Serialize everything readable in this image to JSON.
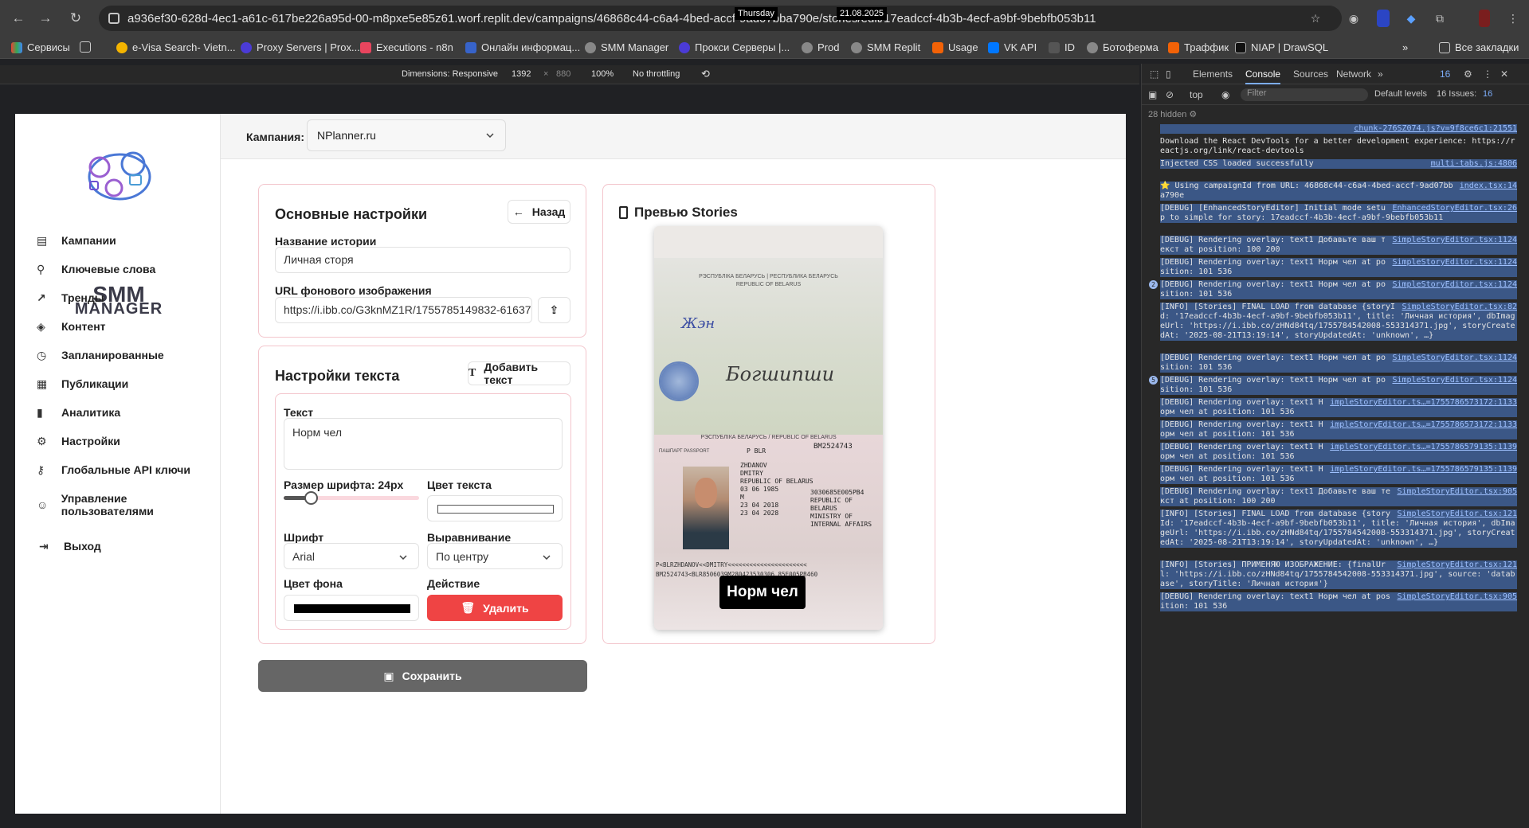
{
  "browser": {
    "url": "a936ef30-628d-4ec1-a61c-617be226a95d-00-m8pxe5e85z61.worf.replit.dev/campaigns/46868c44-c6a4-4bed-accf-9ad07bba790e/stories/edit/17eadccf-4b3b-4ecf-a9bf-9bebfb053b11",
    "tooltip_day": "Thursday",
    "tooltip_date": "21.08.2025",
    "bookmarks": [
      "Сервисы",
      "e-Visa Search- Vietn...",
      "Proxy Servers | Prox...",
      "Executions - n8n",
      "Онлайн информац...",
      "SMM Manager",
      "Прокси Серверы |...",
      "Prod",
      "SMM Replit",
      "Usage",
      "VK API",
      "ID",
      "Ботоферма",
      "Траффик",
      "NIAP | DrawSQL"
    ],
    "all_bookmarks": "Все закладки"
  },
  "device_toolbar": {
    "dimensions_label": "Dimensions: Responsive",
    "width": "1392",
    "x": "×",
    "height": "880",
    "zoom": "100%",
    "throttle": "No throttling"
  },
  "sidebar": {
    "logo_line1": "SMM",
    "logo_line2": "MANAGER",
    "items": [
      "Кампании",
      "Ключевые слова",
      "Тренды",
      "Контент",
      "Запланированные",
      "Публикации",
      "Аналитика",
      "Настройки",
      "Глобальные API ключи",
      "Управление пользователями"
    ],
    "logout": "Выход"
  },
  "header": {
    "campaign_label": "Кампания:",
    "campaign_value": "NPlanner.ru"
  },
  "basic": {
    "title": "Основные настройки",
    "back": "Назад",
    "story_name_label": "Название истории",
    "story_name_value": "Личная сторя",
    "bg_url_label": "URL фонового изображения",
    "bg_url_value": "https://i.ibb.co/G3knMZ1R/1755785149832-616376551-pass"
  },
  "text_settings": {
    "title": "Настройки текста",
    "add_text": "Добавить текст",
    "text_label": "Текст",
    "text_value": "Норм чел",
    "font_size_label": "Размер шрифта: 24px",
    "font_size_value": 24,
    "text_color_label": "Цвет текста",
    "text_color": "#ffffff",
    "font_label": "Шрифт",
    "font_value": "Arial",
    "align_label": "Выравнивание",
    "align_value": "По центру",
    "bg_color_label": "Цвет фона",
    "bg_color": "#000000",
    "action_label": "Действие",
    "delete": "Удалить"
  },
  "save": "Сохранить",
  "preview": {
    "title": "Превью Stories",
    "overlay_text": "Норм чел"
  },
  "devtools": {
    "tabs": [
      "Elements",
      "Console",
      "Sources",
      "Network"
    ],
    "issues_badge": "16",
    "context": "top",
    "filter_placeholder": "Filter",
    "levels": "Default levels",
    "issues": "16 Issues:",
    "issues_count": "16",
    "hidden": "28 hidden",
    "logs": [
      {
        "src": "chunk-276SZ074.js?v=9f8ce6c1:21551",
        "text": ""
      },
      {
        "src": "",
        "text": "Download the React DevTools for a better development experience: https://reactjs.org/link/react-devtools",
        "plain": true
      },
      {
        "src": "multi-tabs.js:4806",
        "text": "Injected CSS loaded successfully"
      },
      {
        "src": "index.tsx:14",
        "text": "⭐ Using campaignId from URL: 46868c44-c6a4-4bed-accf-9ad07bba790e"
      },
      {
        "src": "EnhancedStoryEditor.tsx:26",
        "text": "[DEBUG] [EnhancedStoryEditor] Initial mode setup to simple for story: 17eadccf-4b3b-4ecf-a9bf-9bebfb053b11"
      },
      {
        "src": "SimpleStoryEditor.tsx:1124",
        "text": "[DEBUG] Rendering overlay: text1 Добавьте ваш текст at position: 100 200"
      },
      {
        "src": "SimpleStoryEditor.tsx:1124",
        "text": "[DEBUG] Rendering overlay: text1 Норм чел at position: 101 536"
      },
      {
        "src": "SimpleStoryEditor.tsx:1124",
        "text": "[DEBUG] Rendering overlay: text1 Норм чел at position: 101 536",
        "count": "2"
      },
      {
        "src": "SimpleStoryEditor.tsx:82",
        "text": "[INFO] [Stories] FINAL LOAD from database {storyId: '17eadccf-4b3b-4ecf-a9bf-9bebfb053b11', title: 'Личная история', dbImageUrl: 'https://i.ibb.co/zHNd84tq/1755784542008-553314371.jpg', storyCreatedAt: '2025-08-21T13:19:14', storyUpdatedAt: 'unknown', …}"
      },
      {
        "src": "SimpleStoryEditor.tsx:1124",
        "text": "[DEBUG] Rendering overlay: text1 Норм чел at position: 101 536"
      },
      {
        "src": "SimpleStoryEditor.tsx:1124",
        "text": "[DEBUG] Rendering overlay: text1 Норм чел at position: 101 536",
        "count": "5"
      },
      {
        "src": "impleStoryEditor.ts…=1755786573172:1133",
        "text": "[DEBUG] Rendering overlay: text1 Норм чел at position: 101 536"
      },
      {
        "src": "impleStoryEditor.ts…=1755786573172:1133",
        "text": "[DEBUG] Rendering overlay: text1 Норм чел at position: 101 536"
      },
      {
        "src": "impleStoryEditor.ts…=1755786579135:1139",
        "text": "[DEBUG] Rendering overlay: text1 Норм чел at position: 101 536"
      },
      {
        "src": "impleStoryEditor.ts…=1755786579135:1139",
        "text": "[DEBUG] Rendering overlay: text1 Норм чел at position: 101 536"
      },
      {
        "src": "SimpleStoryEditor.tsx:905",
        "text": "[DEBUG] Rendering overlay: text1 Добавьте ваш текст at position: 100 200"
      },
      {
        "src": "SimpleStoryEditor.tsx:121",
        "text": "[INFO] [Stories] FINAL LOAD from database {storyId: '17eadccf-4b3b-4ecf-a9bf-9bebfb053b11', title: 'Личная история', dbImageUrl: 'https://i.ibb.co/zHNd84tq/1755784542008-553314371.jpg', storyCreatedAt: '2025-08-21T13:19:14', storyUpdatedAt: 'unknown', …}"
      },
      {
        "src": "SimpleStoryEditor.tsx:121",
        "text": "[INFO] [Stories] ПРИМЕНЯЮ ИЗОБРАЖЕНИЕ: {finalUrl: 'https://i.ibb.co/zHNd84tq/1755784542008-553314371.jpg', source: 'database', storyTitle: 'Личная история'}"
      },
      {
        "src": "SimpleStoryEditor.tsx:905",
        "text": "[DEBUG] Rendering overlay: text1 Норм чел at position: 101 536"
      }
    ]
  },
  "passport": {
    "header1": "РЭСПУБЛІКА БЕЛАРУСЬ | РЕСПУБЛИКА БЕЛАРУСЬ",
    "header2": "REPUBLIC OF BELARUS",
    "signature": "Богшипши",
    "header3": "РЭСПУБЛІКА БЕЛАРУСЬ / REPUBLIC OF BELARUS",
    "doc_type": "ПАШПАРТ PASSPORT",
    "code": "P    BLR",
    "number": "BM2524743",
    "surname": "ZHDANOV",
    "name": "DMITRY",
    "nationality": "REPUBLIC OF BELARUS",
    "dob": "03 06 1985",
    "pid": "3030685E005PB4",
    "sex": "M",
    "pob": "REPUBLIC OF BELARUS",
    "issued": "23 04 2018",
    "authority": "MINISTRY OF INTERNAL AFFAIRS",
    "expiry": "23 04 2028",
    "mrz1": "P<BLRZHDANOV<<DMITRY<<<<<<<<<<<<<<<<<<<<<<",
    "mrz2": "BM2524743<BLR8506039M280423530306 85E005PB460"
  }
}
